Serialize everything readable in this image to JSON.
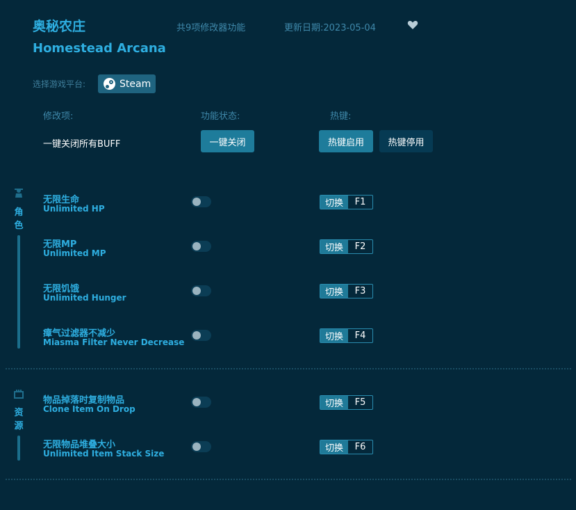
{
  "header": {
    "title_cn": "奥秘农庄",
    "title_en": "Homestead Arcana",
    "feature_count": "共9项修改器功能",
    "update_date": "更新日期:2023-05-04"
  },
  "platform": {
    "label": "选择游戏平台:",
    "selected": "Steam"
  },
  "columns": {
    "item": "修改项:",
    "status": "功能状态:",
    "hotkey": "热键:"
  },
  "global": {
    "label": "一键关闭所有BUFF",
    "close_all": "一键关闭",
    "hotkey_enable": "热键启用",
    "hotkey_disable": "热键停用"
  },
  "sections": [
    {
      "label": [
        "角",
        "色"
      ],
      "icon": "character-icon",
      "items": [
        {
          "cn": "无限生命",
          "en": "Unlimited HP",
          "enabled": false,
          "switch": "切换",
          "key": "F1"
        },
        {
          "cn": "无限MP",
          "en": "Unlimited MP",
          "enabled": false,
          "switch": "切换",
          "key": "F2"
        },
        {
          "cn": "无限饥饿",
          "en": "Unlimited Hunger",
          "enabled": false,
          "switch": "切换",
          "key": "F3"
        },
        {
          "cn": "瘴气过滤器不减少",
          "en": "Miasma Filter Never Decrease",
          "enabled": false,
          "switch": "切换",
          "key": "F4"
        }
      ]
    },
    {
      "label": [
        "资",
        "源"
      ],
      "icon": "resource-icon",
      "items": [
        {
          "cn": "物品掉落时复制物品",
          "en": "Clone Item On Drop",
          "enabled": false,
          "switch": "切换",
          "key": "F5"
        },
        {
          "cn": "无限物品堆叠大小",
          "en": "Unlimited Item Stack Size",
          "enabled": false,
          "switch": "切换",
          "key": "F6"
        }
      ]
    }
  ],
  "icons": {
    "favorite": "heart-icon",
    "platform": "steam-icon"
  },
  "colors": {
    "background": "#04283a",
    "accent": "#2eaee0",
    "button": "#1e7c9b",
    "button_dark": "#063a53"
  }
}
